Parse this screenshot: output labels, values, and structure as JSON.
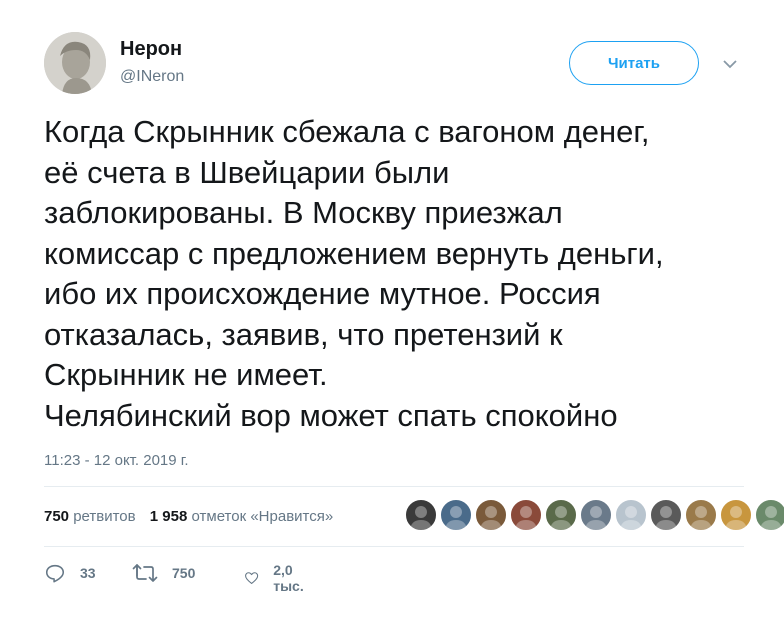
{
  "author": {
    "name": "Нерон",
    "handle": "@INeron"
  },
  "follow_button": {
    "label": "Читать"
  },
  "tweet": {
    "lines": [
      "Когда Скрынник сбежала с вагоном денег,",
      "её счета в Швейцарии были",
      "заблокированы. В Москву приезжал",
      "комиссар с предложением вернуть деньги,",
      "ибо их происхождение мутное. Россия",
      "отказалась, заявив, что претензий к",
      "Скрынник не имеет.",
      "Челябинский вор может спать спокойно"
    ],
    "timestamp": "11:23 - 12 окт. 2019 г."
  },
  "stats": {
    "retweets_count": "750",
    "retweets_label": "ретвитов",
    "likes_count": "1 958",
    "likes_label": "отметок «Нравится»"
  },
  "likers": [
    {
      "color": "#3a3a3a"
    },
    {
      "color": "#4a6b8a"
    },
    {
      "color": "#7a5a3a"
    },
    {
      "color": "#8a4a3a"
    },
    {
      "color": "#5a6a4a"
    },
    {
      "color": "#6a7a8a"
    },
    {
      "color": "#b8c4ce"
    },
    {
      "color": "#5a5a5a"
    },
    {
      "color": "#9a7a4a"
    },
    {
      "color": "#c8963e"
    },
    {
      "color": "#6a8a6a"
    }
  ],
  "actions": {
    "reply_count": "33",
    "retweet_count": "750",
    "like_count": "2,0 тыс."
  },
  "colors": {
    "accent": "#1da1f2",
    "secondary_text": "#657786",
    "divider": "#e6ecf0"
  }
}
